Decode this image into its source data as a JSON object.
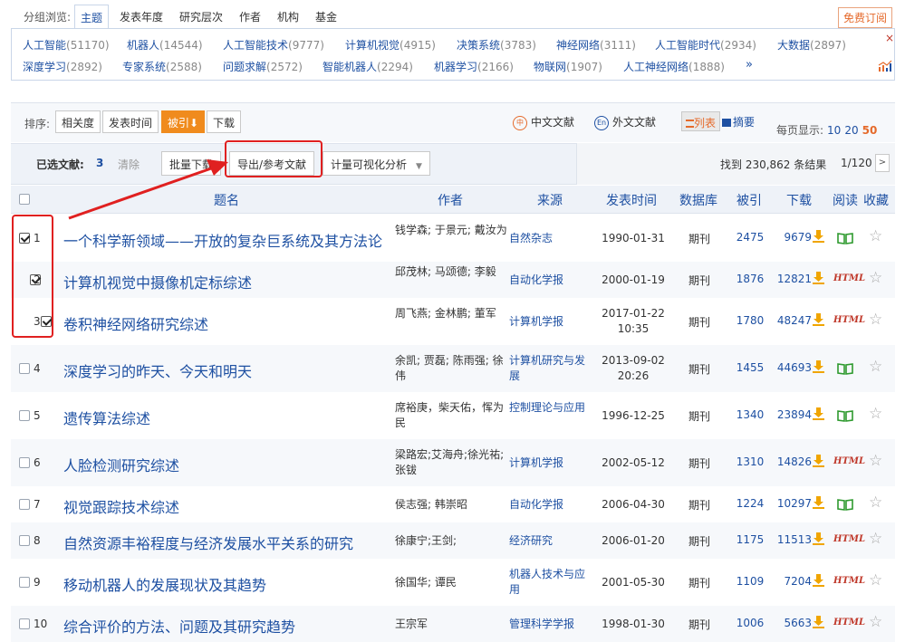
{
  "group_nav": {
    "label": "分组浏览:",
    "tabs": [
      "主题",
      "发表年度",
      "研究层次",
      "作者",
      "机构",
      "基金"
    ],
    "active_tab": "主题",
    "subscribe_label": "免费订阅"
  },
  "categories": [
    {
      "name": "人工智能",
      "count": "(51170)"
    },
    {
      "name": "机器人",
      "count": "(14544)"
    },
    {
      "name": "人工智能技术",
      "count": "(9777)"
    },
    {
      "name": "计算机视觉",
      "count": "(4915)"
    },
    {
      "name": "决策系统",
      "count": "(3783)"
    },
    {
      "name": "神经网络",
      "count": "(3111)"
    },
    {
      "name": "人工智能时代",
      "count": "(2934)"
    },
    {
      "name": "大数据",
      "count": "(2897)"
    },
    {
      "name": "深度学习",
      "count": "(2892)"
    },
    {
      "name": "专家系统",
      "count": "(2588)"
    },
    {
      "name": "问题求解",
      "count": "(2572)"
    },
    {
      "name": "智能机器人",
      "count": "(2294)"
    },
    {
      "name": "机器学习",
      "count": "(2166)"
    },
    {
      "name": "物联网",
      "count": "(1907)"
    },
    {
      "name": "人工神经网络",
      "count": "(1888)"
    }
  ],
  "categories_more": "»",
  "categories_close": "×",
  "sort": {
    "label": "排序:",
    "buttons": [
      "相关度",
      "发表时间",
      "被引",
      "下载"
    ],
    "active": "被引",
    "active_arrow": "⬇"
  },
  "lang": {
    "zh": "中文文献",
    "zh_icon": "中",
    "en": "外文文献",
    "en_icon": "En"
  },
  "view": {
    "list": "列表",
    "abstract": "摘要"
  },
  "per_page": {
    "label": "每页显示:",
    "options": [
      "10",
      "20",
      "50"
    ],
    "selected": "50"
  },
  "selection": {
    "label": "已选文献:",
    "count": "3",
    "clear": "清除",
    "batch_download": "批量下载",
    "export": "导出/参考文献",
    "visual_analysis": "计量可视化分析",
    "found": "找到 230,862 条结果",
    "pager": "1/120",
    "next": ">"
  },
  "table_headers": {
    "title": "题名",
    "author": "作者",
    "source": "来源",
    "date": "发表时间",
    "db": "数据库",
    "cite": "被引",
    "download": "下载",
    "read": "阅读",
    "fav": "收藏"
  },
  "rows": [
    {
      "num": "1",
      "checked": true,
      "title": "一个科学新领域——开放的复杂巨系统及其方法论",
      "author": "钱学森; 于景元; 戴汝为",
      "source": "自然杂志",
      "date": "1990-01-31",
      "db": "期刊",
      "cite": "2475",
      "download": "9679",
      "read": "book"
    },
    {
      "num": "2",
      "checked": true,
      "title": "计算机视觉中摄像机定标综述",
      "author": "邱茂林; 马颂德; 李毅",
      "source": "自动化学报",
      "date": "2000-01-19",
      "db": "期刊",
      "cite": "1876",
      "download": "12821",
      "read": "HTML"
    },
    {
      "num": "3",
      "checked": true,
      "title": "卷积神经网络研究综述",
      "author": "周飞燕; 金林鹏; 董军",
      "source": "计算机学报",
      "date": "2017-01-22 10:35",
      "db": "期刊",
      "cite": "1780",
      "download": "48247",
      "read": "HTML"
    },
    {
      "num": "4",
      "checked": false,
      "title": "深度学习的昨天、今天和明天",
      "author": "余凯; 贾磊; 陈雨强; 徐伟",
      "source": "计算机研究与发展",
      "date": "2013-09-02 20:26",
      "db": "期刊",
      "cite": "1455",
      "download": "44693",
      "read": "book"
    },
    {
      "num": "5",
      "checked": false,
      "title": "遗传算法综述",
      "author": "席裕庚，柴天佑，恽为民",
      "source": "控制理论与应用",
      "date": "1996-12-25",
      "db": "期刊",
      "cite": "1340",
      "download": "23894",
      "read": "book"
    },
    {
      "num": "6",
      "checked": false,
      "title": "人脸检测研究综述",
      "author": "梁路宏;艾海舟;徐光祐;张钹",
      "source": "计算机学报",
      "date": "2002-05-12",
      "db": "期刊",
      "cite": "1310",
      "download": "14826",
      "read": "HTML"
    },
    {
      "num": "7",
      "checked": false,
      "title": "视觉跟踪技术综述",
      "author": "侯志强; 韩崇昭",
      "source": "自动化学报",
      "date": "2006-04-30",
      "db": "期刊",
      "cite": "1224",
      "download": "10297",
      "read": "book"
    },
    {
      "num": "8",
      "checked": false,
      "title": "自然资源丰裕程度与经济发展水平关系的研究",
      "author": "徐康宁;王剑;",
      "source": "经济研究",
      "date": "2006-01-20",
      "db": "期刊",
      "cite": "1175",
      "download": "11513",
      "read": "HTML"
    },
    {
      "num": "9",
      "checked": false,
      "title": "移动机器人的发展现状及其趋势",
      "author": "徐国华; 谭民",
      "source": "机器人技术与应用",
      "date": "2001-05-30",
      "db": "期刊",
      "cite": "1109",
      "download": "7204",
      "read": "HTML"
    },
    {
      "num": "10",
      "checked": false,
      "title": "综合评价的方法、问题及其研究趋势",
      "author": "王宗军",
      "source": "管理科学学报",
      "date": "1998-01-30",
      "db": "期刊",
      "cite": "1006",
      "download": "5663",
      "read": "HTML"
    }
  ],
  "colors": {
    "accent": "#e56a2b",
    "link": "#1e50a2",
    "highlight": "#e02020",
    "active_sort": "#f08b1d"
  }
}
